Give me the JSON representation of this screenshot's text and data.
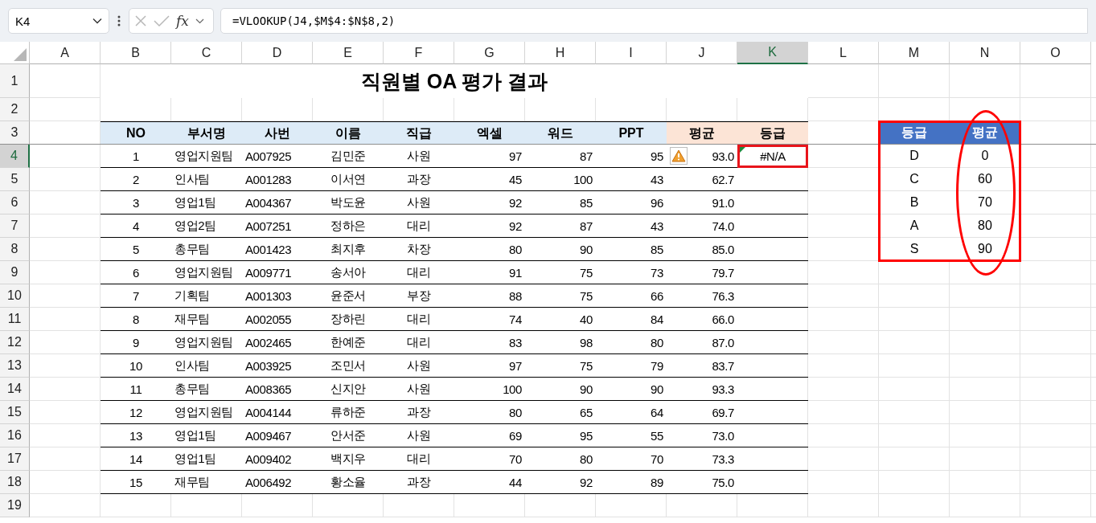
{
  "name_box": {
    "value": "K4"
  },
  "formula_bar": {
    "function_label": "fx",
    "value": "=VLOOKUP(J4,$M$4:$N$8,2)"
  },
  "columns": [
    {
      "label": "A",
      "selected": false
    },
    {
      "label": "B",
      "selected": false
    },
    {
      "label": "C",
      "selected": false
    },
    {
      "label": "D",
      "selected": false
    },
    {
      "label": "E",
      "selected": false
    },
    {
      "label": "F",
      "selected": false
    },
    {
      "label": "G",
      "selected": false
    },
    {
      "label": "H",
      "selected": false
    },
    {
      "label": "I",
      "selected": false
    },
    {
      "label": "J",
      "selected": false
    },
    {
      "label": "K",
      "selected": true
    },
    {
      "label": "L",
      "selected": false
    },
    {
      "label": "M",
      "selected": false
    },
    {
      "label": "N",
      "selected": false
    },
    {
      "label": "O",
      "selected": false
    }
  ],
  "rows": [
    {
      "label": "1",
      "selected": false
    },
    {
      "label": "2",
      "selected": false
    },
    {
      "label": "3",
      "selected": false
    },
    {
      "label": "4",
      "selected": true
    },
    {
      "label": "5",
      "selected": false
    },
    {
      "label": "6",
      "selected": false
    },
    {
      "label": "7",
      "selected": false
    },
    {
      "label": "8",
      "selected": false
    },
    {
      "label": "9",
      "selected": false
    },
    {
      "label": "10",
      "selected": false
    },
    {
      "label": "11",
      "selected": false
    },
    {
      "label": "12",
      "selected": false
    },
    {
      "label": "13",
      "selected": false
    },
    {
      "label": "14",
      "selected": false
    },
    {
      "label": "15",
      "selected": false
    },
    {
      "label": "16",
      "selected": false
    },
    {
      "label": "17",
      "selected": false
    },
    {
      "label": "18",
      "selected": false
    },
    {
      "label": "19",
      "selected": false
    }
  ],
  "title": "직원별 OA 평가 결과",
  "table": {
    "columns": [
      "NO",
      "부서명",
      "사번",
      "이름",
      "직급",
      "엑셀",
      "워드",
      "PPT",
      "평균",
      "등급"
    ],
    "rows": [
      {
        "cells": [
          "1",
          "영업지원팀",
          "A007925",
          "김민준",
          "사원",
          "97",
          "87",
          "95",
          "93.0"
        ],
        "warning": true,
        "grade": "#N/A"
      },
      {
        "cells": [
          "2",
          "인사팀",
          "A001283",
          "이서연",
          "과장",
          "45",
          "100",
          "43",
          "62.7"
        ],
        "warning": false
      },
      {
        "cells": [
          "3",
          "영업1팀",
          "A004367",
          "박도윤",
          "사원",
          "92",
          "85",
          "96",
          "91.0"
        ],
        "warning": false
      },
      {
        "cells": [
          "4",
          "영업2팀",
          "A007251",
          "정하은",
          "대리",
          "92",
          "87",
          "43",
          "74.0"
        ],
        "warning": false
      },
      {
        "cells": [
          "5",
          "총무팀",
          "A001423",
          "최지후",
          "차장",
          "80",
          "90",
          "85",
          "85.0"
        ],
        "warning": false
      },
      {
        "cells": [
          "6",
          "영업지원팀",
          "A009771",
          "송서아",
          "대리",
          "91",
          "75",
          "73",
          "79.7"
        ],
        "warning": false
      },
      {
        "cells": [
          "7",
          "기획팀",
          "A001303",
          "윤준서",
          "부장",
          "88",
          "75",
          "66",
          "76.3"
        ],
        "warning": false
      },
      {
        "cells": [
          "8",
          "재무팀",
          "A002055",
          "장하린",
          "대리",
          "74",
          "40",
          "84",
          "66.0"
        ],
        "warning": false
      },
      {
        "cells": [
          "9",
          "영업지원팀",
          "A002465",
          "한예준",
          "대리",
          "83",
          "98",
          "80",
          "87.0"
        ],
        "warning": false
      },
      {
        "cells": [
          "10",
          "인사팀",
          "A003925",
          "조민서",
          "사원",
          "97",
          "75",
          "79",
          "83.7"
        ],
        "warning": false
      },
      {
        "cells": [
          "11",
          "총무팀",
          "A008365",
          "신지안",
          "사원",
          "100",
          "90",
          "90",
          "93.3"
        ],
        "warning": false
      },
      {
        "cells": [
          "12",
          "영업지원팀",
          "A004144",
          "류하준",
          "과장",
          "80",
          "65",
          "64",
          "69.7"
        ],
        "warning": false
      },
      {
        "cells": [
          "13",
          "영업1팀",
          "A009467",
          "안서준",
          "사원",
          "69",
          "95",
          "55",
          "73.0"
        ],
        "warning": false
      },
      {
        "cells": [
          "14",
          "영업1팀",
          "A009402",
          "백지우",
          "대리",
          "70",
          "80",
          "70",
          "73.3"
        ],
        "warning": false
      },
      {
        "cells": [
          "15",
          "재무팀",
          "A006492",
          "황소율",
          "과장",
          "44",
          "92",
          "89",
          "75.0"
        ],
        "warning": false
      }
    ]
  },
  "grade_table": {
    "columns": [
      "등급",
      "평균"
    ],
    "rows": [
      [
        "D",
        "0"
      ],
      [
        "C",
        "60"
      ],
      [
        "B",
        "70"
      ],
      [
        "A",
        "80"
      ],
      [
        "S",
        "90"
      ]
    ]
  }
}
